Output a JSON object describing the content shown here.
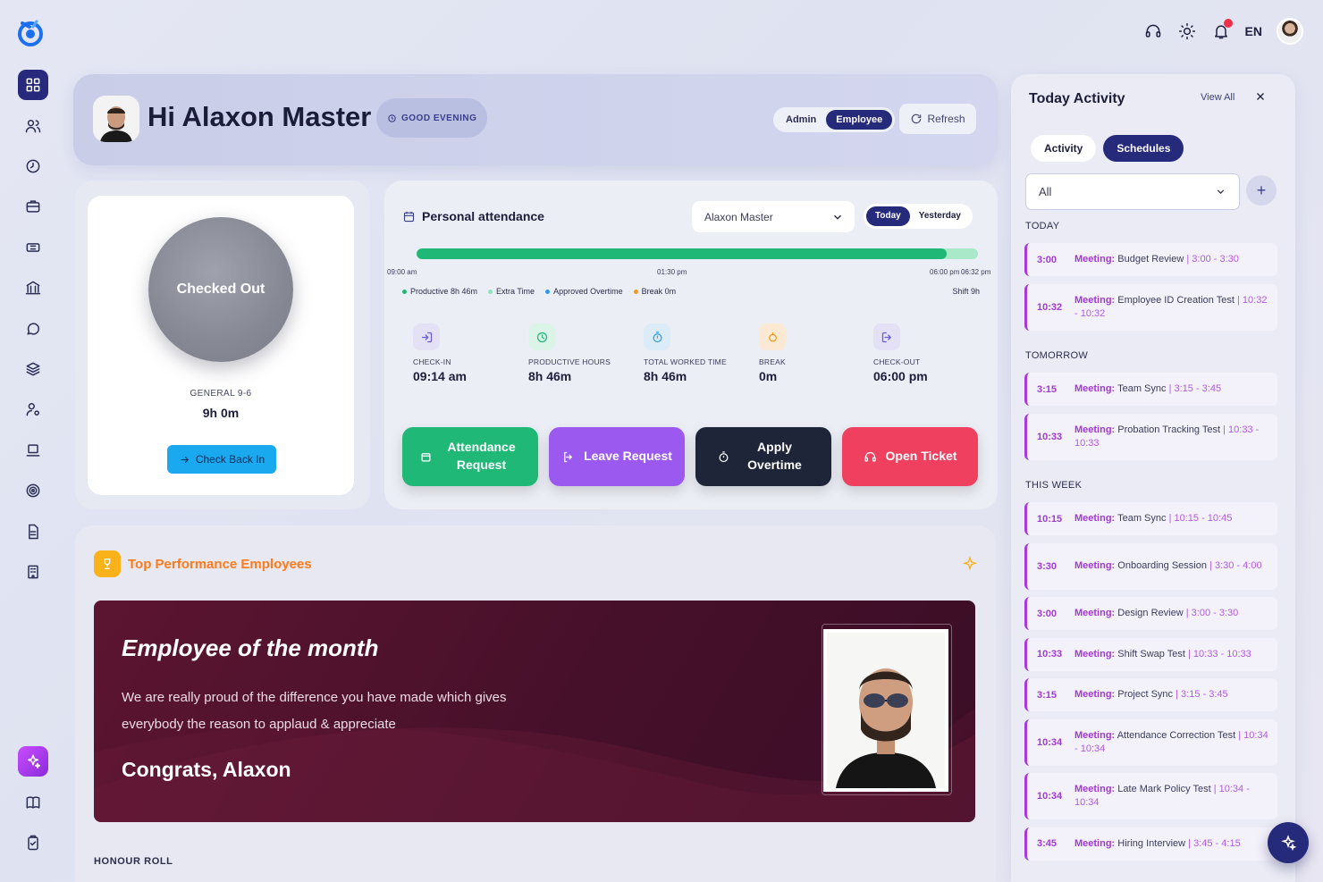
{
  "topbar": {
    "lang": "EN"
  },
  "greeting": {
    "title": "Hi Alaxon Master",
    "pill": "GOOD EVENING",
    "roles": [
      "Admin",
      "Employee"
    ],
    "active_role": "Employee",
    "refresh_label": "Refresh"
  },
  "check": {
    "status": "Checked Out",
    "shift_name": "GENERAL 9-6",
    "shift_hours": "9h 0m",
    "button_label": "Check Back In"
  },
  "attendance": {
    "title": "Personal attendance",
    "employee_select": "Alaxon Master",
    "day_options": [
      "Today",
      "Yesterday"
    ],
    "active_day": "Today",
    "progress_fraction": 0.945,
    "ticks": [
      "09:00 am",
      "01:30 pm",
      "06:00 pm",
      "06:32 pm"
    ],
    "legend": [
      {
        "label": "Productive 8h 46m",
        "color": "#1fb877"
      },
      {
        "label": "Extra Time",
        "color": "#8fe2bb"
      },
      {
        "label": "Approved Overtime",
        "color": "#2f9ae8"
      },
      {
        "label": "Break 0m",
        "color": "#f39a1a"
      }
    ],
    "shift_total": "Shift 9h",
    "stats": [
      {
        "label": "CHECK-IN",
        "value": "09:14 am",
        "icon": "login-icon",
        "color": "#6a5cd6",
        "bg": "#e4e1f7"
      },
      {
        "label": "PRODUCTIVE HOURS",
        "value": "8h 46m",
        "icon": "clock-icon",
        "color": "#1fb877",
        "bg": "#dcf3e8"
      },
      {
        "label": "TOTAL WORKED TIME",
        "value": "8h 46m",
        "icon": "timer-icon",
        "color": "#2f9ae8",
        "bg": "#dcebf8"
      },
      {
        "label": "BREAK",
        "value": "0m",
        "icon": "break-icon",
        "color": "#f39a1a",
        "bg": "#fbe9d3"
      },
      {
        "label": "CHECK-OUT",
        "value": "06:00 pm",
        "icon": "logout-icon",
        "color": "#6a5cd6",
        "bg": "#e4e1f7"
      }
    ],
    "actions": [
      {
        "label": "Attendance Request",
        "color": "#1fb877"
      },
      {
        "label": "Leave Request",
        "color": "#9b59f0"
      },
      {
        "label": "Apply Overtime",
        "color": "#1e2538"
      },
      {
        "label": "Open Ticket",
        "color": "#ef4060"
      }
    ]
  },
  "performance": {
    "title": "Top Performance Employees",
    "eom_title": "Employee of the month",
    "eom_text": "We are really proud of the difference you have made which gives everybody the reason to applaud & appreciate",
    "congrats": "Congrats, Alaxon",
    "honour_roll": "HONOUR ROLL"
  },
  "activity": {
    "title": "Today Activity",
    "view_all": "View All",
    "tabs": [
      "Activity",
      "Schedules"
    ],
    "active_tab": "Schedules",
    "filter": "All",
    "sections": [
      {
        "label": "TODAY",
        "events": [
          {
            "time": "3:00",
            "type": "Meeting:",
            "name": "Budget Review",
            "range": "3:00 - 3:30"
          },
          {
            "time": "10:32",
            "type": "Meeting:",
            "name": "Employee ID Creation Test",
            "range": "10:32 - 10:32"
          }
        ]
      },
      {
        "label": "TOMORROW",
        "events": [
          {
            "time": "3:15",
            "type": "Meeting:",
            "name": "Team Sync",
            "range": "3:15 - 3:45"
          },
          {
            "time": "10:33",
            "type": "Meeting:",
            "name": "Probation Tracking Test",
            "range": "10:33 - 10:33"
          }
        ]
      },
      {
        "label": "THIS WEEK",
        "events": [
          {
            "time": "10:15",
            "type": "Meeting:",
            "name": "Team Sync",
            "range": "10:15 - 10:45"
          },
          {
            "time": "3:30",
            "type": "Meeting:",
            "name": "Onboarding Session",
            "range": "3:30 - 4:00"
          },
          {
            "time": "3:00",
            "type": "Meeting:",
            "name": "Design Review",
            "range": "3:00 - 3:30"
          },
          {
            "time": "10:33",
            "type": "Meeting:",
            "name": "Shift Swap Test",
            "range": "10:33 - 10:33"
          },
          {
            "time": "3:15",
            "type": "Meeting:",
            "name": "Project Sync",
            "range": "3:15 - 3:45"
          },
          {
            "time": "10:34",
            "type": "Meeting:",
            "name": "Attendance Correction Test",
            "range": "10:34 - 10:34"
          },
          {
            "time": "10:34",
            "type": "Meeting:",
            "name": "Late Mark Policy Test",
            "range": "10:34 - 10:34"
          },
          {
            "time": "3:45",
            "type": "Meeting:",
            "name": "Hiring Interview",
            "range": "3:45 - 4:15"
          }
        ]
      }
    ]
  }
}
